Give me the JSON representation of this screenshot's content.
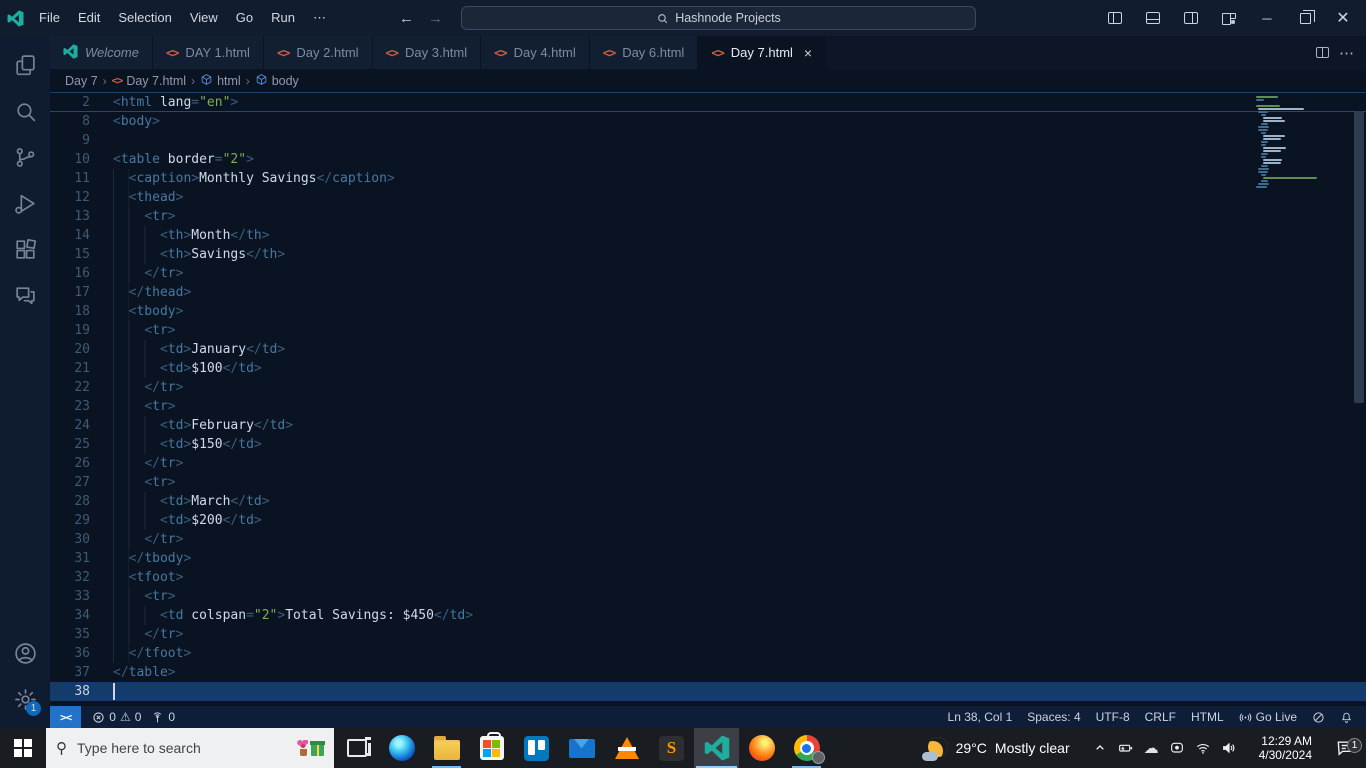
{
  "titlebar": {
    "menus": [
      "File",
      "Edit",
      "Selection",
      "View",
      "Go",
      "Run",
      "⋯"
    ],
    "back_arrow": "←",
    "forward_arrow": "→",
    "search_label": "Hashnode Projects",
    "search_icon": "⌕"
  },
  "activity_bar": {
    "top_icons": [
      {
        "name": "explorer-icon"
      },
      {
        "name": "search-icon"
      },
      {
        "name": "source-control-icon"
      },
      {
        "name": "run-debug-icon"
      },
      {
        "name": "extensions-icon"
      },
      {
        "name": "chat-icon"
      }
    ],
    "bottom_icons": [
      {
        "name": "account-icon"
      },
      {
        "name": "settings-gear-icon",
        "badge": "1"
      }
    ]
  },
  "tabs": [
    {
      "label": "Welcome",
      "icon": "vscode",
      "italic": true
    },
    {
      "label": "DAY 1.html",
      "icon": "html"
    },
    {
      "label": "Day 2.html",
      "icon": "html"
    },
    {
      "label": "Day 3.html",
      "icon": "html"
    },
    {
      "label": "Day 4.html",
      "icon": "html"
    },
    {
      "label": "Day 6.html",
      "icon": "html"
    },
    {
      "label": "Day 7.html",
      "icon": "html",
      "active": true,
      "close": "×"
    }
  ],
  "breadcrumb": [
    {
      "label": "Day 7"
    },
    {
      "label": "Day 7.html",
      "icon": "html"
    },
    {
      "label": "html",
      "icon": "symbol-cube"
    },
    {
      "label": "body",
      "icon": "symbol-cube"
    }
  ],
  "editor": {
    "sticky_line": {
      "n": 2,
      "t": "<html lang=\"en\">"
    },
    "lines": [
      {
        "n": 8,
        "t": "<body>"
      },
      {
        "n": 9,
        "t": ""
      },
      {
        "n": 10,
        "t": "<table border=\"2\">"
      },
      {
        "n": 11,
        "t": "  <caption>Monthly Savings</caption>"
      },
      {
        "n": 12,
        "t": "  <thead>"
      },
      {
        "n": 13,
        "t": "    <tr>"
      },
      {
        "n": 14,
        "t": "      <th>Month</th>"
      },
      {
        "n": 15,
        "t": "      <th>Savings</th>"
      },
      {
        "n": 16,
        "t": "    </tr>"
      },
      {
        "n": 17,
        "t": "  </thead>"
      },
      {
        "n": 18,
        "t": "  <tbody>"
      },
      {
        "n": 19,
        "t": "    <tr>"
      },
      {
        "n": 20,
        "t": "      <td>January</td>"
      },
      {
        "n": 21,
        "t": "      <td>$100</td>"
      },
      {
        "n": 22,
        "t": "    </tr>"
      },
      {
        "n": 23,
        "t": "    <tr>"
      },
      {
        "n": 24,
        "t": "      <td>February</td>"
      },
      {
        "n": 25,
        "t": "      <td>$150</td>"
      },
      {
        "n": 26,
        "t": "    </tr>"
      },
      {
        "n": 27,
        "t": "    <tr>"
      },
      {
        "n": 28,
        "t": "      <td>March</td>"
      },
      {
        "n": 29,
        "t": "      <td>$200</td>"
      },
      {
        "n": 30,
        "t": "    </tr>"
      },
      {
        "n": 31,
        "t": "  </tbody>"
      },
      {
        "n": 32,
        "t": "  <tfoot>"
      },
      {
        "n": 33,
        "t": "    <tr>"
      },
      {
        "n": 34,
        "t": "      <td colspan=\"2\">Total Savings: $450</td>"
      },
      {
        "n": 35,
        "t": "    </tr>"
      },
      {
        "n": 36,
        "t": "  </tfoot>"
      },
      {
        "n": 37,
        "t": "</table>"
      },
      {
        "n": 38,
        "t": "",
        "cursor": true
      }
    ],
    "cursor": {
      "line": 38,
      "col": 1
    }
  },
  "status_bar": {
    "remote_indicator": "><",
    "errors": "0",
    "warnings": "0",
    "ports": "0",
    "right_items": [
      "Ln 38, Col 1",
      "Spaces: 4",
      "UTF-8",
      "CRLF",
      "HTML"
    ],
    "go_live_label": "Go Live"
  },
  "taskbar": {
    "search_placeholder": "Type here to search",
    "apps": [
      {
        "name": "task-view"
      },
      {
        "name": "edge"
      },
      {
        "name": "file-explorer",
        "running": true
      },
      {
        "name": "microsoft-store"
      },
      {
        "name": "trello"
      },
      {
        "name": "mail"
      },
      {
        "name": "vlc"
      },
      {
        "name": "sublime-text"
      },
      {
        "name": "vscode",
        "running": true,
        "active": true
      },
      {
        "name": "firefox"
      },
      {
        "name": "chrome",
        "running": true
      }
    ],
    "weather": {
      "temp": "29°C",
      "desc": "Mostly clear"
    },
    "clock": {
      "time": "12:29 AM",
      "date": "4/30/2024"
    },
    "notification_badge": "1"
  },
  "colors": {
    "accent_blue": "#2472c8",
    "cursor_line": "#133c6d",
    "html_icon_orange": "#d2603f",
    "tag_blue": "#4579a1",
    "attr_orange": "#d6985c",
    "string_green": "#7fae55",
    "text_white": "#cfdbe8"
  }
}
